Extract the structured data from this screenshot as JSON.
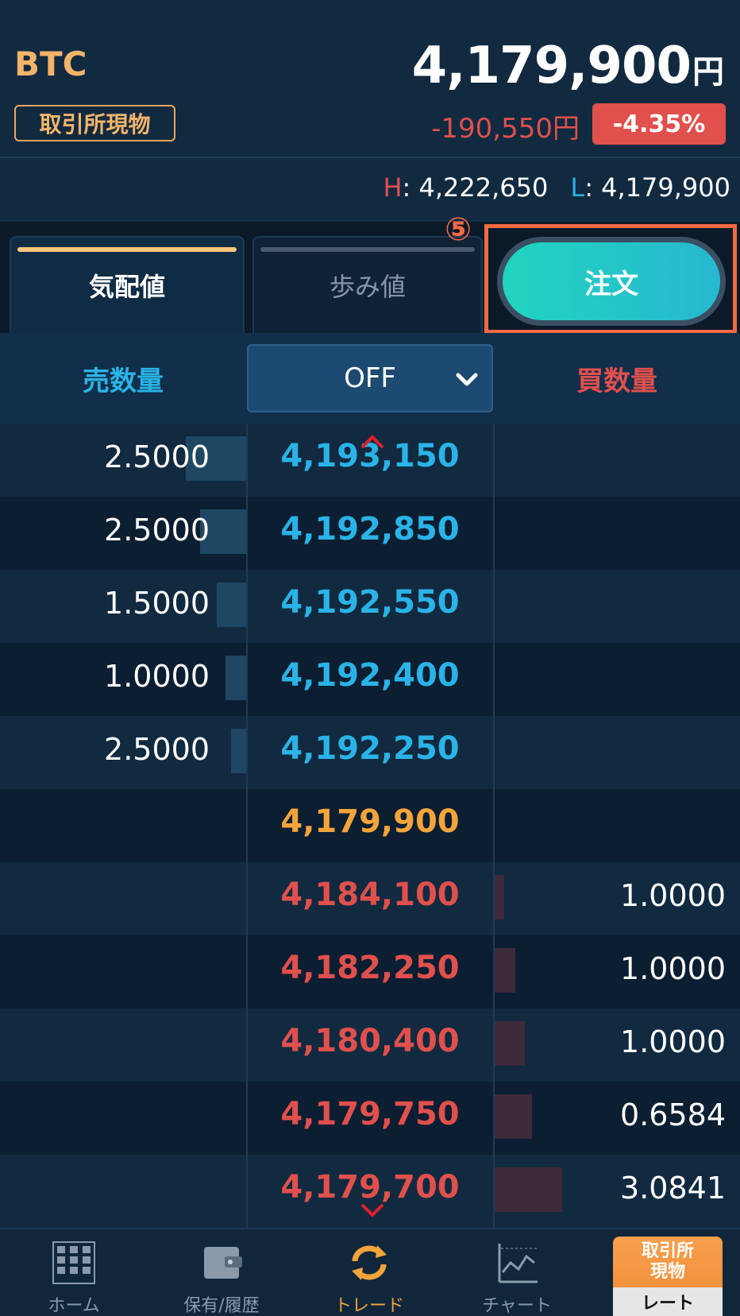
{
  "header": {
    "symbol": "BTC",
    "market": "取引所現物",
    "price": "4,179,900",
    "currency": "円",
    "change": "-190,550円",
    "change_pct": "-4.35%",
    "high_label": "H",
    "high": "4,222,650",
    "low_label": "L",
    "low": "4,179,900"
  },
  "tabs": [
    {
      "label": "気配値"
    },
    {
      "label": "歩み値"
    }
  ],
  "step_marker": "⑤",
  "order_button": "注文",
  "columns": {
    "sell_qty": "売数量",
    "filter": "OFF",
    "buy_qty": "買数量"
  },
  "asks": [
    {
      "qty": "2.5000",
      "price": "4,193,150",
      "depth": 0.82
    },
    {
      "qty": "2.5000",
      "price": "4,192,850",
      "depth": 0.62
    },
    {
      "qty": "1.5000",
      "price": "4,192,550",
      "depth": 0.4
    },
    {
      "qty": "1.0000",
      "price": "4,192,400",
      "depth": 0.28
    },
    {
      "qty": "2.5000",
      "price": "4,192,250",
      "depth": 0.2
    }
  ],
  "last_price": "4,179,900",
  "bids": [
    {
      "qty": "1.0000",
      "price": "4,184,100",
      "depth": 0.09
    },
    {
      "qty": "1.0000",
      "price": "4,182,250",
      "depth": 0.18
    },
    {
      "qty": "1.0000",
      "price": "4,180,400",
      "depth": 0.26
    },
    {
      "qty": "0.6584",
      "price": "4,179,750",
      "depth": 0.32
    },
    {
      "qty": "3.0841",
      "price": "4,179,700",
      "depth": 0.58
    }
  ],
  "nav": [
    {
      "label": "ホーム",
      "icon": "grid-icon"
    },
    {
      "label": "保有/履歴",
      "icon": "wallet-icon"
    },
    {
      "label": "トレード",
      "icon": "exchange-arrows-icon"
    },
    {
      "label": "チャート",
      "icon": "chart-icon"
    }
  ],
  "rate_button": {
    "top": "取引所\n現物",
    "bottom": "レート"
  },
  "colors": {
    "ask": "#2ab3e6",
    "bid": "#e0504d",
    "last": "#f3a43a",
    "accent": "#f26a43"
  }
}
